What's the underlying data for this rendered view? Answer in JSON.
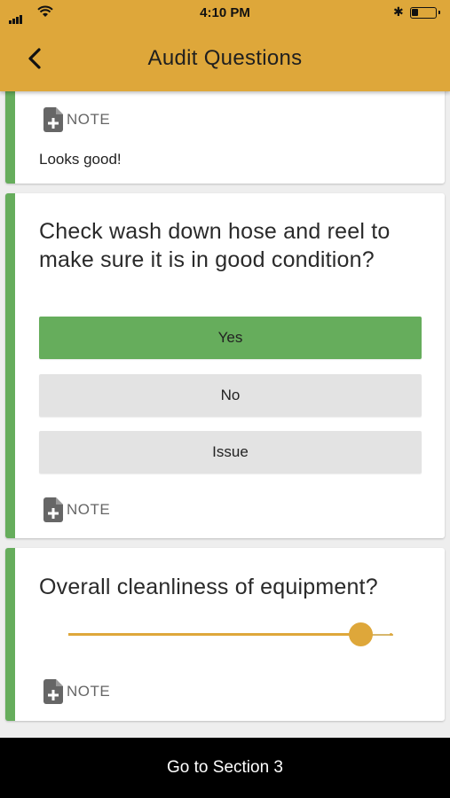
{
  "status_bar": {
    "time": "4:10 PM"
  },
  "header": {
    "title": "Audit Questions"
  },
  "card1": {
    "note_label": "NOTE",
    "note_text": "Looks good!"
  },
  "card2": {
    "question": "Check wash down hose and reel to make sure it is in good condition?",
    "options": [
      {
        "label": "Yes",
        "selected": true
      },
      {
        "label": "No",
        "selected": false
      },
      {
        "label": "Issue",
        "selected": false
      }
    ],
    "note_label": "NOTE"
  },
  "card3": {
    "question": "Overall cleanliness of equipment?",
    "slider_value_fraction": 0.9,
    "note_label": "NOTE"
  },
  "footer": {
    "label": "Go to Section 3"
  },
  "colors": {
    "header": "#dea73a",
    "accent_green": "#66ad5c",
    "slider": "#dea73a",
    "footer": "#000000"
  },
  "icons": [
    "back-arrow-icon",
    "note-add-icon",
    "wifi-icon",
    "bluetooth-icon",
    "battery-icon"
  ]
}
